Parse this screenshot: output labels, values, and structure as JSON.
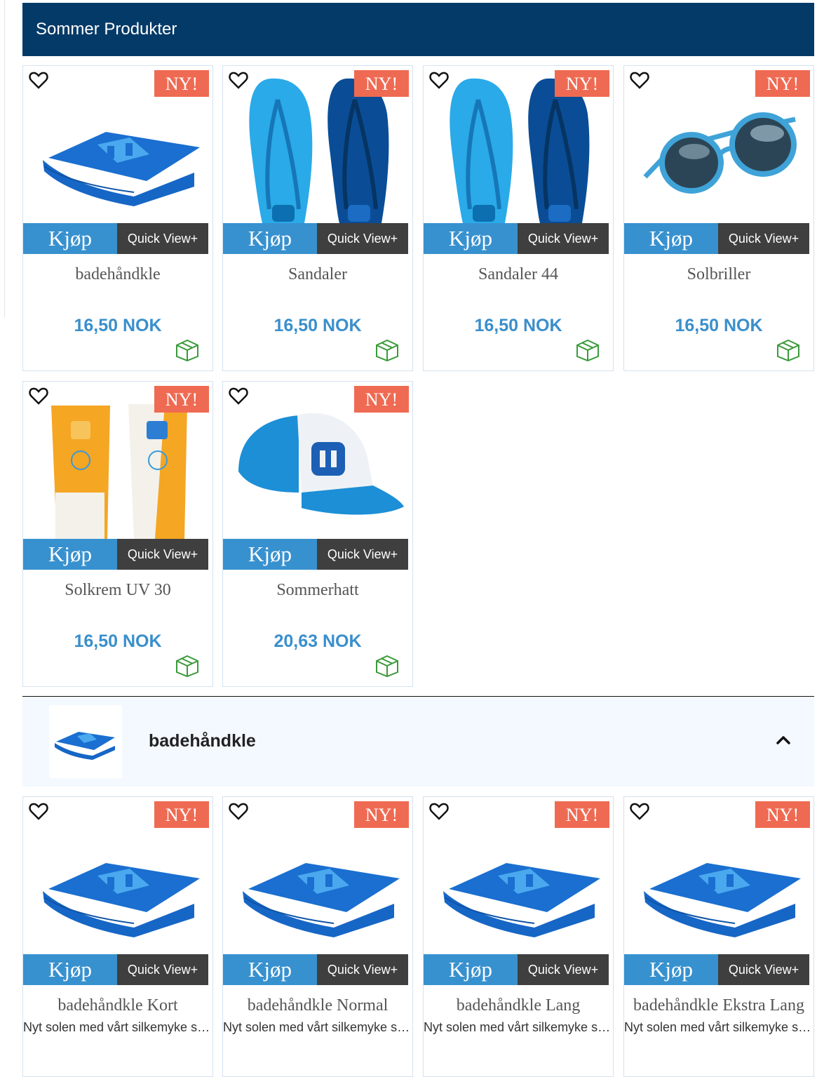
{
  "section": {
    "title": "Sommer Produkter"
  },
  "badge_text": "NY!",
  "buy_label": "Kjøp",
  "quickview_label": "Quick View+",
  "products": [
    {
      "name": "badehåndkle",
      "price": "16,50 NOK"
    },
    {
      "name": "Sandaler",
      "price": "16,50 NOK"
    },
    {
      "name": "Sandaler 44",
      "price": "16,50 NOK"
    },
    {
      "name": "Solbriller",
      "price": "16,50 NOK"
    },
    {
      "name": "Solkrem UV 30",
      "price": "16,50 NOK"
    },
    {
      "name": "Sommerhatt",
      "price": "20,63 NOK"
    }
  ],
  "category": {
    "title": "badehåndkle"
  },
  "variants": [
    {
      "name": "badehåndkle Kort",
      "desc": "Nyt solen med vårt silkemyke stranda håndkle"
    },
    {
      "name": "badehåndkle Normal",
      "desc": "Nyt solen med vårt silkemyke stranda håndkle"
    },
    {
      "name": "badehåndkle Lang",
      "desc": "Nyt solen med vårt silkemyke stranda håndkle"
    },
    {
      "name": "badehåndkle Ekstra Lang",
      "desc": "Nyt solen med vårt silkemyke stranda håndkle"
    }
  ],
  "icons": {
    "wishlist": "heart-outline-icon",
    "stock": "package-icon",
    "collapse": "chevron-up-icon"
  },
  "colors": {
    "header_bg": "#043a67",
    "badge": "#ef6a52",
    "buy": "#3891cf",
    "quickview": "#3f3f3f",
    "price": "#3a8fcc",
    "stock_icon": "#3a9a3a"
  }
}
